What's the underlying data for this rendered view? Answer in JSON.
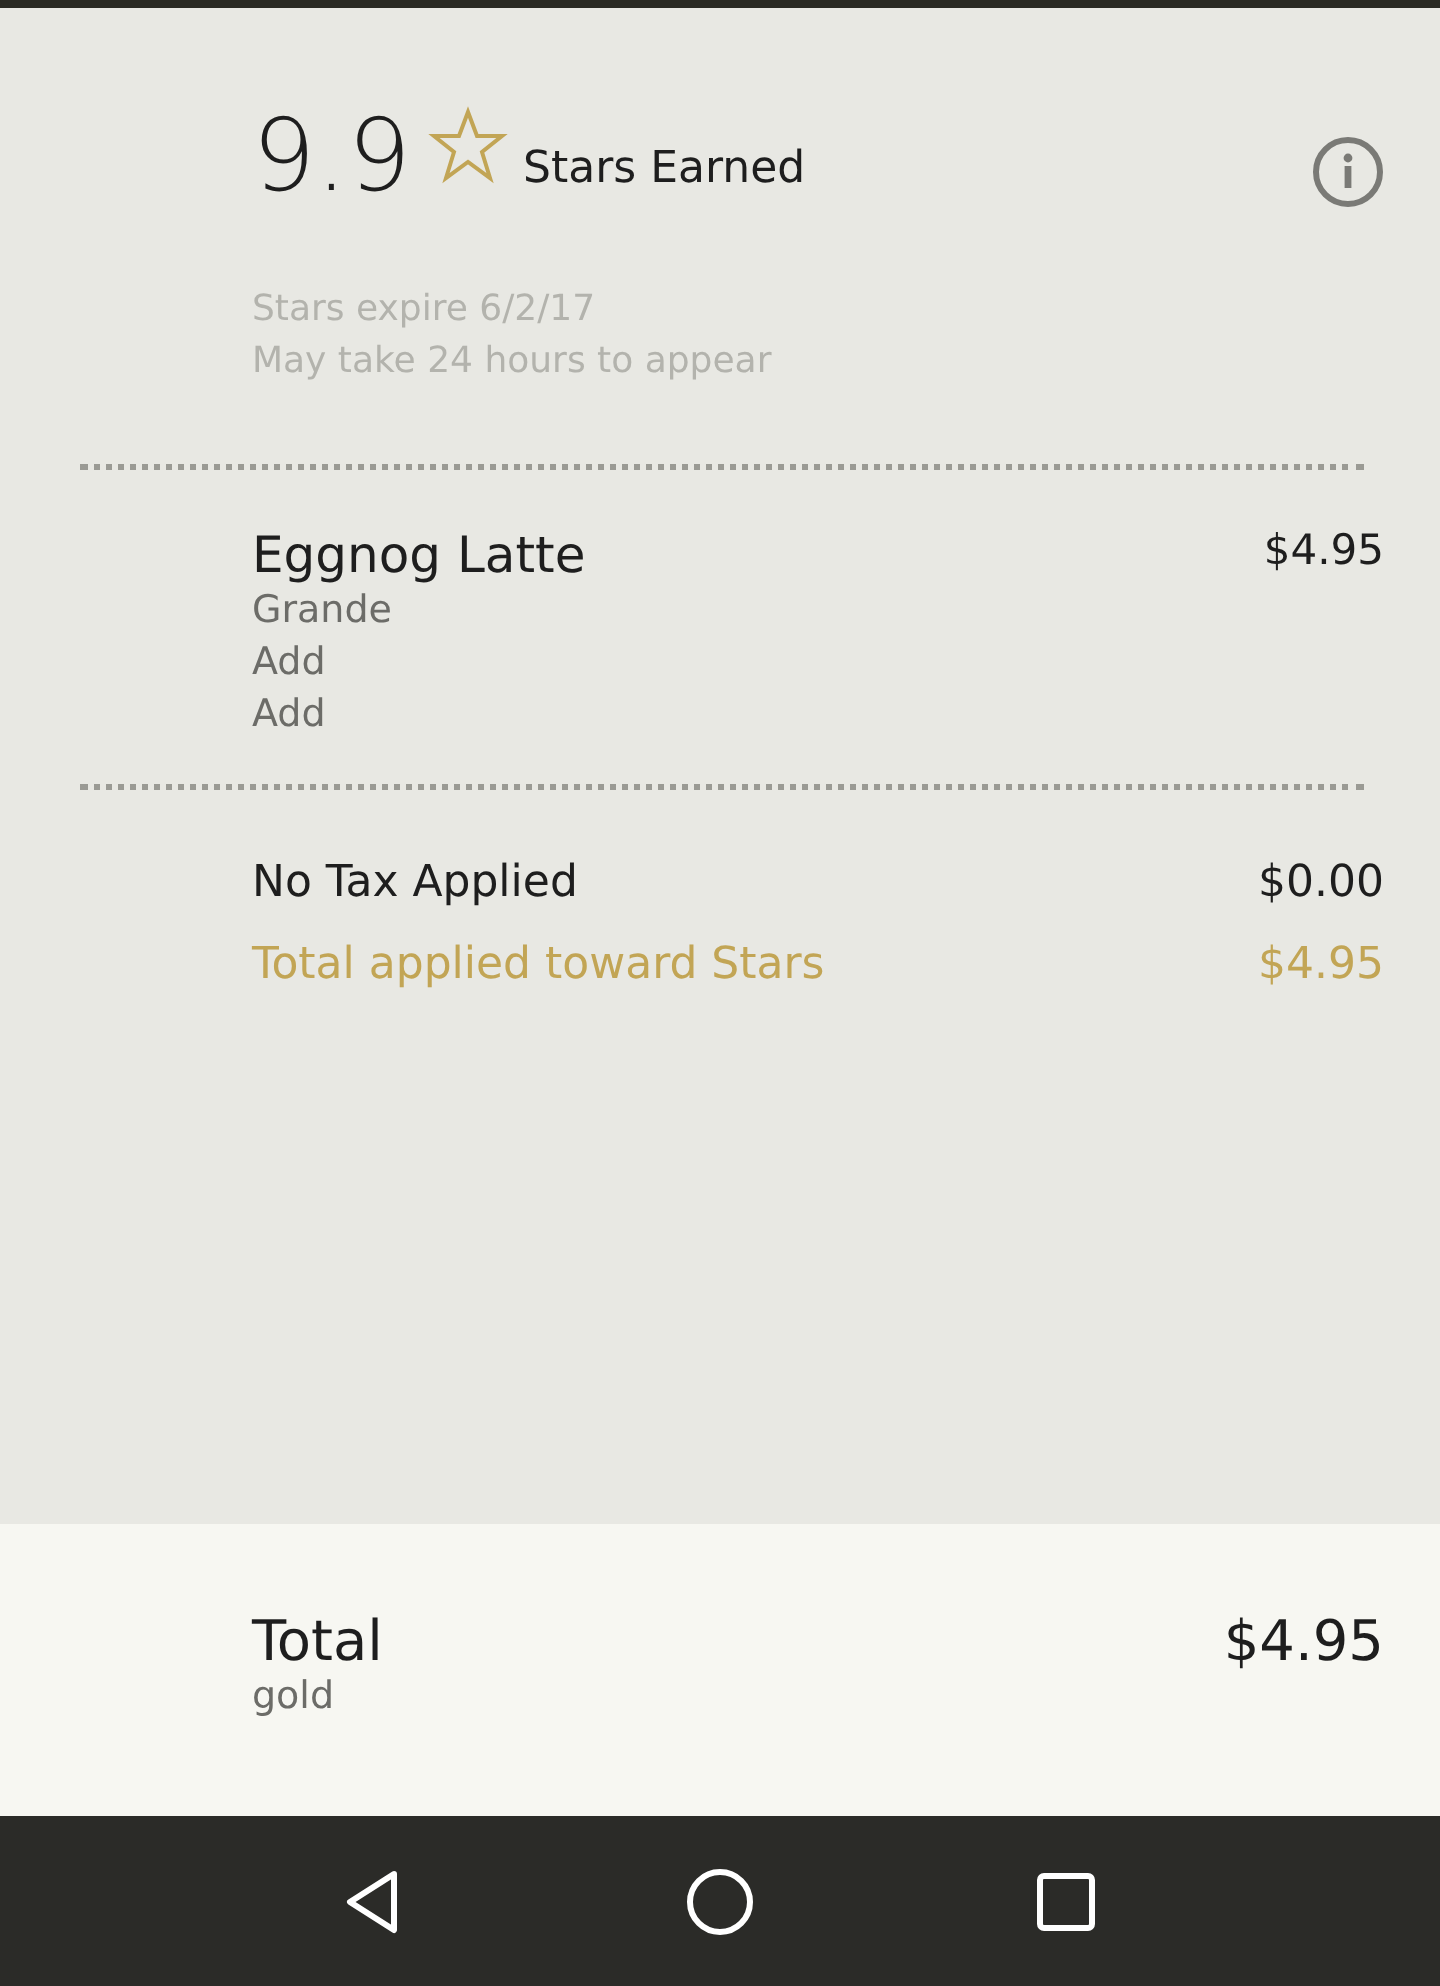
{
  "stars": {
    "earned": "9.9",
    "label": "Stars Earned",
    "expiry": "Stars expire 6/2/17",
    "note": "May take 24 hours to appear"
  },
  "items": [
    {
      "name": "Eggnog Latte",
      "price": "$4.95",
      "modifiers": [
        "Grande",
        "Add",
        "Add"
      ]
    }
  ],
  "summary": [
    {
      "kind": "plain",
      "label": "No Tax Applied",
      "amount": "$0.00"
    },
    {
      "kind": "highlight",
      "label": "Total applied toward Stars",
      "amount": "$4.95"
    }
  ],
  "total": {
    "label": "Total",
    "sublabel": "gold",
    "amount": "$4.95"
  }
}
